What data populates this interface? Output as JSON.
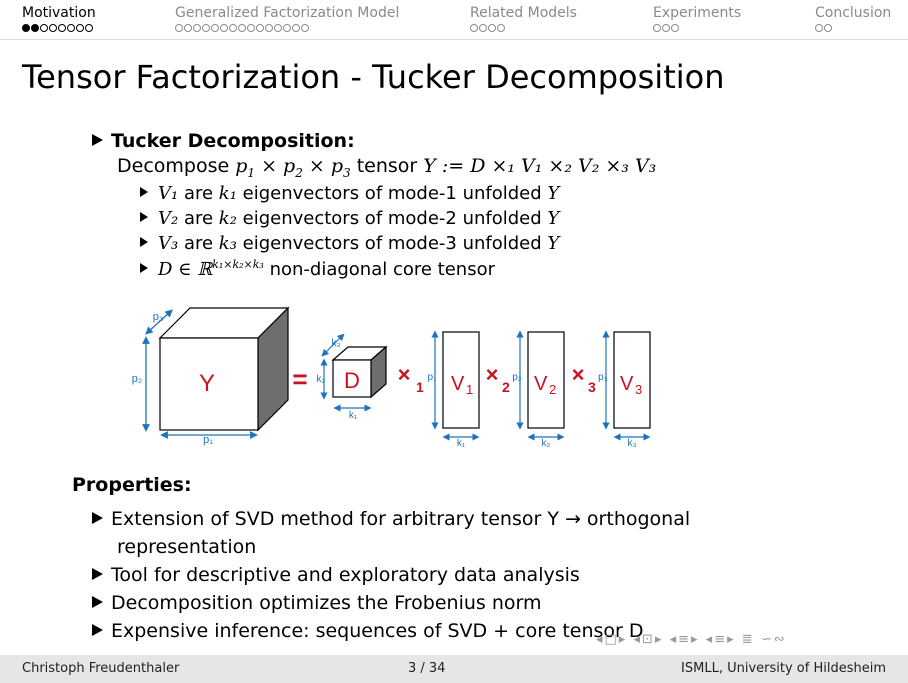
{
  "nav": {
    "sections": [
      {
        "label": "Motivation",
        "dots": 8,
        "filled": 2,
        "active": true
      },
      {
        "label": "Generalized Factorization Model",
        "dots": 15,
        "filled": 0,
        "active": false
      },
      {
        "label": "Related Models",
        "dots": 4,
        "filled": 0,
        "active": false
      },
      {
        "label": "Experiments",
        "dots": 3,
        "filled": 0,
        "active": false
      },
      {
        "label": "Conclusion",
        "dots": 2,
        "filled": 0,
        "active": false
      }
    ]
  },
  "title": "Tensor Factorization - Tucker Decomposition",
  "tucker": {
    "heading": "Tucker Decomposition:",
    "decompose_prefix": "Decompose ",
    "decompose_tensor": " tensor ",
    "formula": "Y := D ×₁ V₁ ×₂ V₂ ×₃ V₃",
    "bullets": [
      {
        "math": "V₁",
        "text1": " are ",
        "k": "k₁",
        "text2": " eigenvectors of mode-1 unfolded ",
        "end": "Y"
      },
      {
        "math": "V₂",
        "text1": " are ",
        "k": "k₂",
        "text2": " eigenvectors of mode-2 unfolded ",
        "end": "Y"
      },
      {
        "math": "V₃",
        "text1": " are ",
        "k": "k₃",
        "text2": " eigenvectors of mode-3 unfolded ",
        "end": "Y"
      }
    ],
    "core_math": "D ∈ ℝ",
    "core_sup": "k₁×k₂×k₃",
    "core_text": " non-diagonal core tensor"
  },
  "diagram": {
    "Y": "Y",
    "D": "D",
    "V1": "V",
    "V2": "V",
    "V3": "V",
    "sub1": "1",
    "sub2": "2",
    "sub3": "3",
    "p1": "p₁",
    "p2": "p₂",
    "p3": "p₃",
    "k1": "k₁",
    "k2": "k₂",
    "k3": "k₃",
    "eq": "=",
    "times": "×"
  },
  "properties": {
    "heading": "Properties:",
    "items": [
      "Extension of SVD method for arbitrary tensor Y → orthogonal",
      "representation",
      "Tool for descriptive and exploratory data analysis",
      "Decomposition optimizes the Frobenius norm",
      "Expensive inference: sequences of SVD + core tensor D"
    ]
  },
  "footer": {
    "author": "Christoph Freudenthaler",
    "page": "3 / 34",
    "institution": "ISMLL, University of Hildesheim"
  },
  "colors": {
    "accent": "#cc1020",
    "arrow": "#1e73be"
  }
}
